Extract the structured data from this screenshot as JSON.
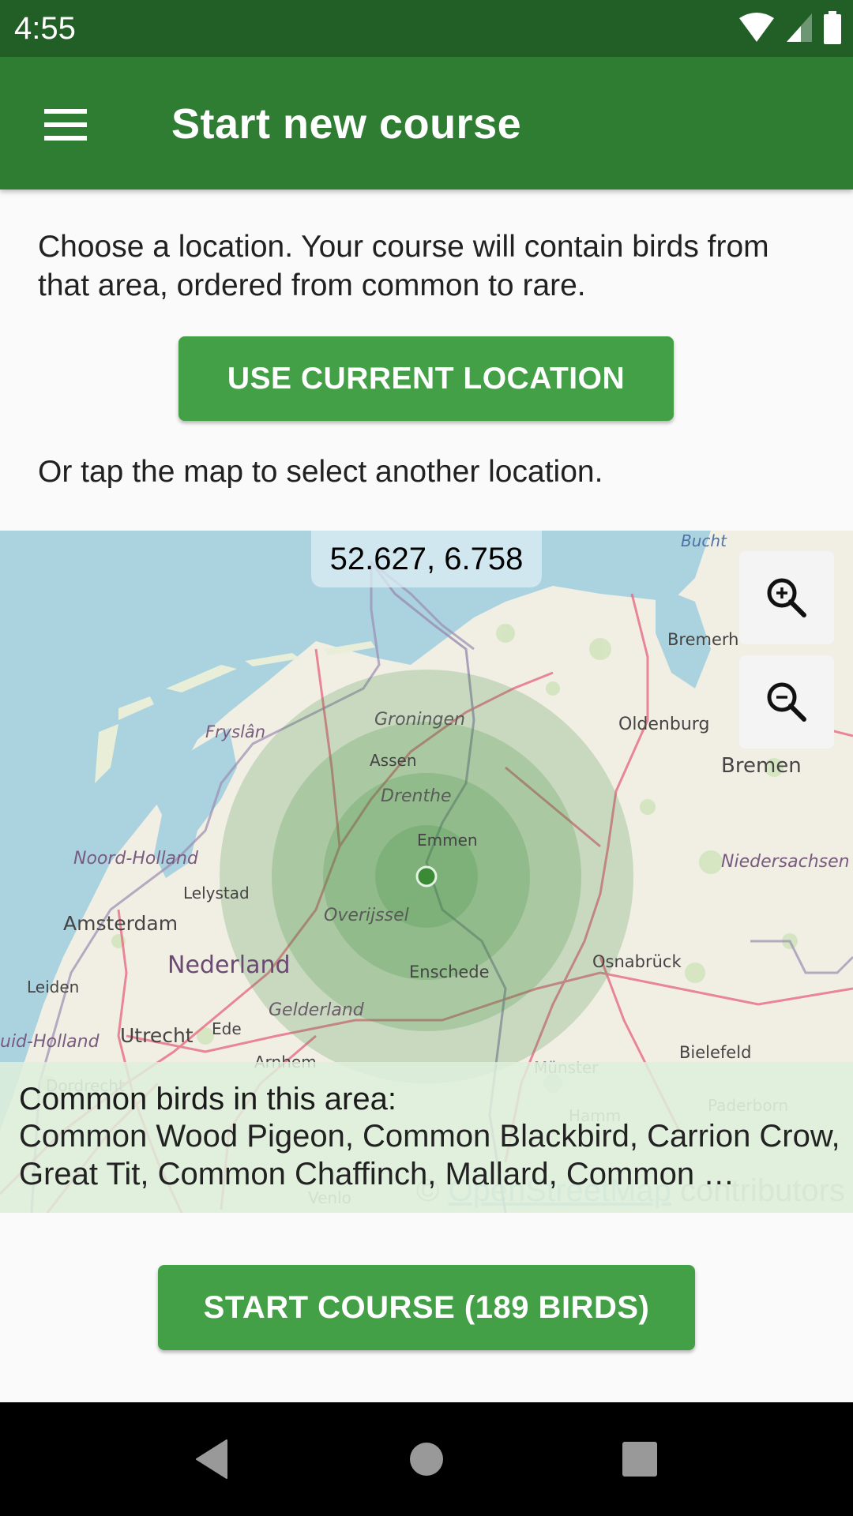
{
  "status_bar": {
    "time": "4:55",
    "icons": [
      "wifi-icon",
      "cell-signal-icon",
      "battery-icon"
    ]
  },
  "app_bar": {
    "title": "Start new course",
    "menu_icon": "hamburger-menu-icon"
  },
  "intro_text": "Choose a location. Your course will contain birds from that area, ordered from common to rare.",
  "use_location_button": "USE CURRENT LOCATION",
  "or_text": "Or tap the map to select another location.",
  "map": {
    "coordinates": "52.627, 6.758",
    "zoom_in_icon": "zoom-in-icon",
    "zoom_out_icon": "zoom-out-icon",
    "labels": {
      "bucht": "Bucht",
      "bremerhaven": "Bremerh",
      "groningen": "Groningen",
      "oldenburg": "Oldenburg",
      "fryslan": "Fryslân",
      "assen": "Assen",
      "bremen": "Bremen",
      "drenthe": "Drenthe",
      "emmen": "Emmen",
      "noord_holland": "Noord-Holland",
      "niedersachsen": "Niedersachsen",
      "lelystad": "Lelystad",
      "amsterdam": "Amsterdam",
      "overijssel": "Overijssel",
      "nederland": "Nederland",
      "osnabruck": "Osnabrück",
      "leiden": "Leiden",
      "enschede": "Enschede",
      "gelderland": "Gelderland",
      "utrecht": "Utrecht",
      "ede": "Ede",
      "zuid_holland": "uid-Holland",
      "arnhem": "Arnhem",
      "bielefeld": "Bielefeld",
      "munster": "Münster",
      "dordrecht": "Dordrecht",
      "hamm": "Hamm",
      "paderborn": "Paderborn",
      "venlo": "Venlo"
    },
    "attribution_prefix": "© ",
    "attribution_link": "OpenStreetMap",
    "attribution_suffix": " contributors"
  },
  "birds": {
    "heading": "Common birds in this area:",
    "list": "Common Wood Pigeon, Common Blackbird, Carrion Crow, Great Tit, Common Chaffinch, Mallard, Common …"
  },
  "start_button": "START COURSE (189 BIRDS)",
  "nav_bar": {
    "back_icon": "back-icon",
    "home_icon": "home-icon",
    "recents_icon": "recents-icon"
  },
  "colors": {
    "status_bar": "#225f27",
    "app_bar": "#2e7d32",
    "button": "#43a047",
    "radius_fill": "#3d8b3d"
  }
}
